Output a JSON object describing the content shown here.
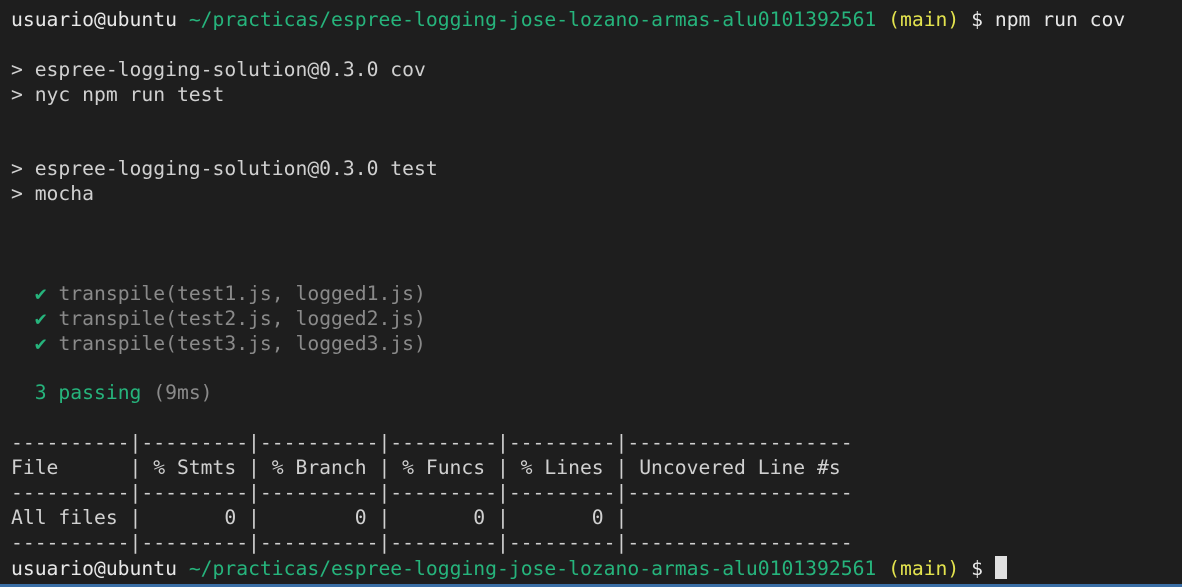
{
  "prompt": {
    "user": "usuario@ubuntu",
    "path": "~/practicas/espree-logging-jose-lozano-armas-alu0101392561",
    "branch": "(main)",
    "symbol": "$"
  },
  "command": "npm run cov",
  "output": {
    "cov_script_header": "> espree-logging-solution@0.3.0 cov",
    "cov_script_cmd": "> nyc npm run test",
    "test_script_header": "> espree-logging-solution@0.3.0 test",
    "test_script_cmd": "> mocha",
    "check_mark": "✔",
    "tests": [
      "transpile(test1.js, logged1.js)",
      "transpile(test2.js, logged2.js)",
      "transpile(test3.js, logged3.js)"
    ],
    "passing": "3 passing",
    "duration": "(9ms)"
  },
  "coverage_table": {
    "separator": "----------|---------|----------|---------|---------|-------------------",
    "header": "File      | % Stmts | % Branch | % Funcs | % Lines | Uncovered Line #s ",
    "row": "All files |       0 |        0 |       0 |       0 |                   "
  },
  "colors": {
    "background": "#1e1e1e",
    "path": "#26b47c",
    "branch": "#e3e34e",
    "dim_text": "#8a8a8a"
  }
}
